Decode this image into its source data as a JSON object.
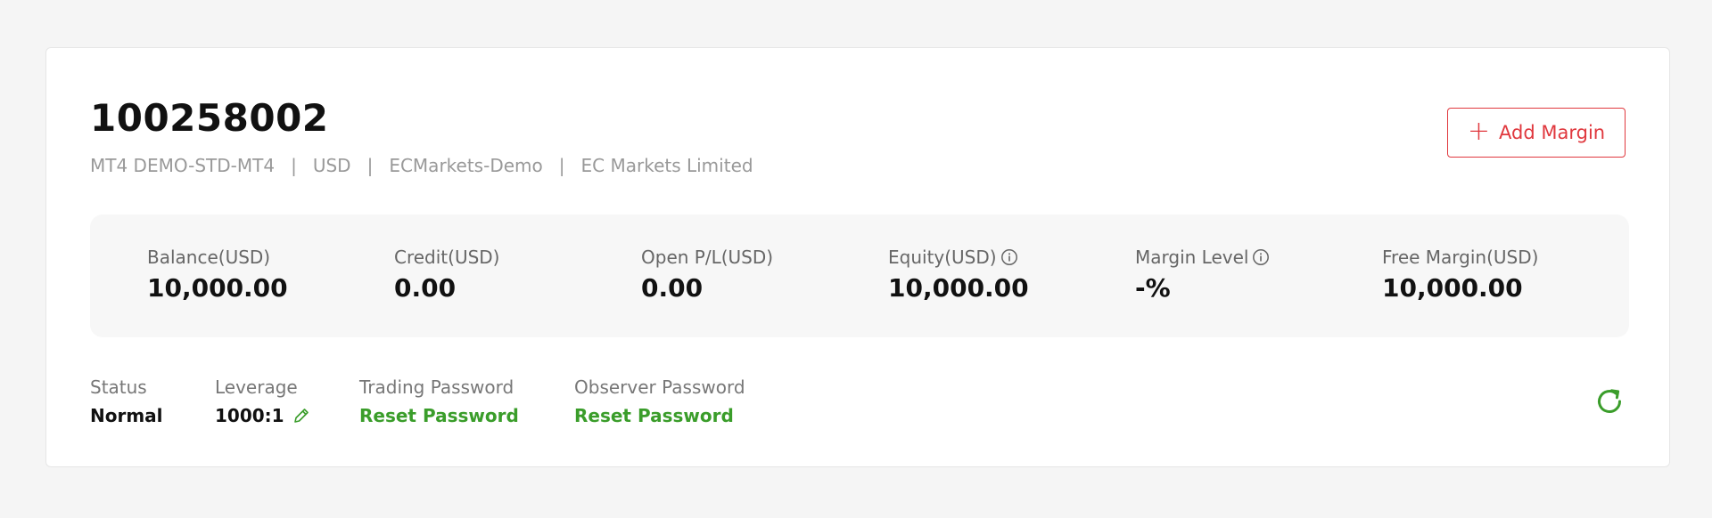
{
  "account": {
    "number": "100258002",
    "meta": [
      "MT4 DEMO-STD-MT4",
      "USD",
      "ECMarkets-Demo",
      "EC Markets Limited"
    ],
    "separator": "|"
  },
  "actions": {
    "add_margin_label": "Add Margin",
    "add_margin_plus": "+"
  },
  "stats": [
    {
      "label": "Balance(USD)",
      "value": "10,000.00",
      "info": false
    },
    {
      "label": "Credit(USD)",
      "value": "0.00",
      "info": false
    },
    {
      "label": "Open P/L(USD)",
      "value": "0.00",
      "info": false
    },
    {
      "label": "Equity(USD)",
      "value": "10,000.00",
      "info": true
    },
    {
      "label": "Margin Level",
      "value": "-%",
      "info": true
    },
    {
      "label": "Free Margin(USD)",
      "value": "10,000.00",
      "info": false
    }
  ],
  "details": {
    "status": {
      "label": "Status",
      "value": "Normal"
    },
    "leverage": {
      "label": "Leverage",
      "value": "1000:1"
    },
    "trading_password": {
      "label": "Trading Password",
      "link": "Reset Password"
    },
    "observer_password": {
      "label": "Observer Password",
      "link": "Reset Password"
    }
  },
  "colors": {
    "accent_red": "#e0383e",
    "accent_green": "#3a9d2a"
  },
  "icons": {
    "add": "plus-icon",
    "info": "info-icon",
    "edit": "pencil-icon",
    "refresh": "refresh-icon"
  }
}
